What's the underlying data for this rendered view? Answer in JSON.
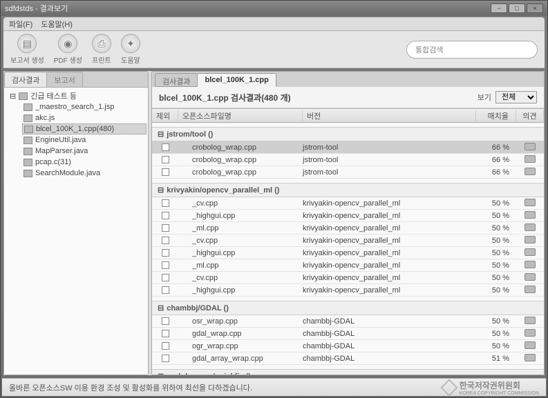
{
  "window": {
    "title": "sdfdstds - 결과보기"
  },
  "menu": {
    "file": "파일(F)",
    "help": "도움말(H)"
  },
  "toolbar": {
    "report": "보고서 생성",
    "pdf": "PDF 생성",
    "print": "프린트",
    "helpbtn": "도움말"
  },
  "search": {
    "placeholder": "통합검색"
  },
  "left": {
    "tab_results": "검사결과",
    "tab_report": "보고서",
    "root": "긴급 테스트 등",
    "items": [
      "_maestro_search_1.jsp",
      "akc.js",
      "blcel_100K_1.cpp(480)",
      "EngineUtil.java",
      "MapParser.java",
      "pcap.c(31)",
      "SearchModule.java"
    ]
  },
  "right": {
    "tab_results": "검사결과",
    "tab_file": "blcel_100K_1.cpp",
    "heading": "blcel_100K_1.cpp 검사결과(480 개)",
    "view_label": "보기",
    "view_value": "전체",
    "cols": {
      "exclude": "제외",
      "filename": "오픈소스파일명",
      "version": "버전",
      "match": "매치율",
      "opinion": "의견"
    },
    "groups": [
      {
        "name": "jstrom/tool ()",
        "rows": [
          {
            "fn": "crobolog_wrap.cpp",
            "ver": "jstrom-tool",
            "mt": "66 %",
            "sel": true
          },
          {
            "fn": "crobolog_wrap.cpp",
            "ver": "jstrom-tool",
            "mt": "66 %"
          },
          {
            "fn": "crobolog_wrap.cpp",
            "ver": "jstrom-tool",
            "mt": "66 %"
          }
        ]
      },
      {
        "name": "krivyakin/opencv_parallel_ml ()",
        "rows": [
          {
            "fn": "_cv.cpp",
            "ver": "krivyakin-opencv_parallel_ml",
            "mt": "50 %"
          },
          {
            "fn": "_highgui.cpp",
            "ver": "krivyakin-opencv_parallel_ml",
            "mt": "50 %"
          },
          {
            "fn": "_ml.cpp",
            "ver": "krivyakin-opencv_parallel_ml",
            "mt": "50 %"
          },
          {
            "fn": "_cv.cpp",
            "ver": "krivyakin-opencv_parallel_ml",
            "mt": "50 %"
          },
          {
            "fn": "_highgui.cpp",
            "ver": "krivyakin-opencv_parallel_ml",
            "mt": "50 %"
          },
          {
            "fn": "_ml.cpp",
            "ver": "krivyakin-opencv_parallel_ml",
            "mt": "50 %"
          },
          {
            "fn": "_cv.cpp",
            "ver": "krivyakin-opencv_parallel_ml",
            "mt": "50 %"
          },
          {
            "fn": "_highgui.cpp",
            "ver": "krivyakin-opencv_parallel_ml",
            "mt": "50 %"
          }
        ]
      },
      {
        "name": "chambbj/GDAL ()",
        "rows": [
          {
            "fn": "osr_wrap.cpp",
            "ver": "chambbj-GDAL",
            "mt": "50 %"
          },
          {
            "fn": "gdal_wrap.cpp",
            "ver": "chambbj-GDAL",
            "mt": "50 %"
          },
          {
            "fn": "ogr_wrap.cpp",
            "ver": "chambbj-GDAL",
            "mt": "50 %"
          },
          {
            "fn": "gdal_array_wrap.cpp",
            "ver": "chambbj-GDAL",
            "mt": "51 %"
          }
        ]
      },
      {
        "name": "rockdreamer/quickfix ()",
        "rows": []
      }
    ]
  },
  "footer": {
    "text": "올바른 오픈소스SW 이용 환경 조성 및 활성화를 위하여 최선을 다하겠습니다.",
    "org": "한국저작권위원회",
    "org_sub": "KOREA COPYRIGHT COMMISSION"
  }
}
